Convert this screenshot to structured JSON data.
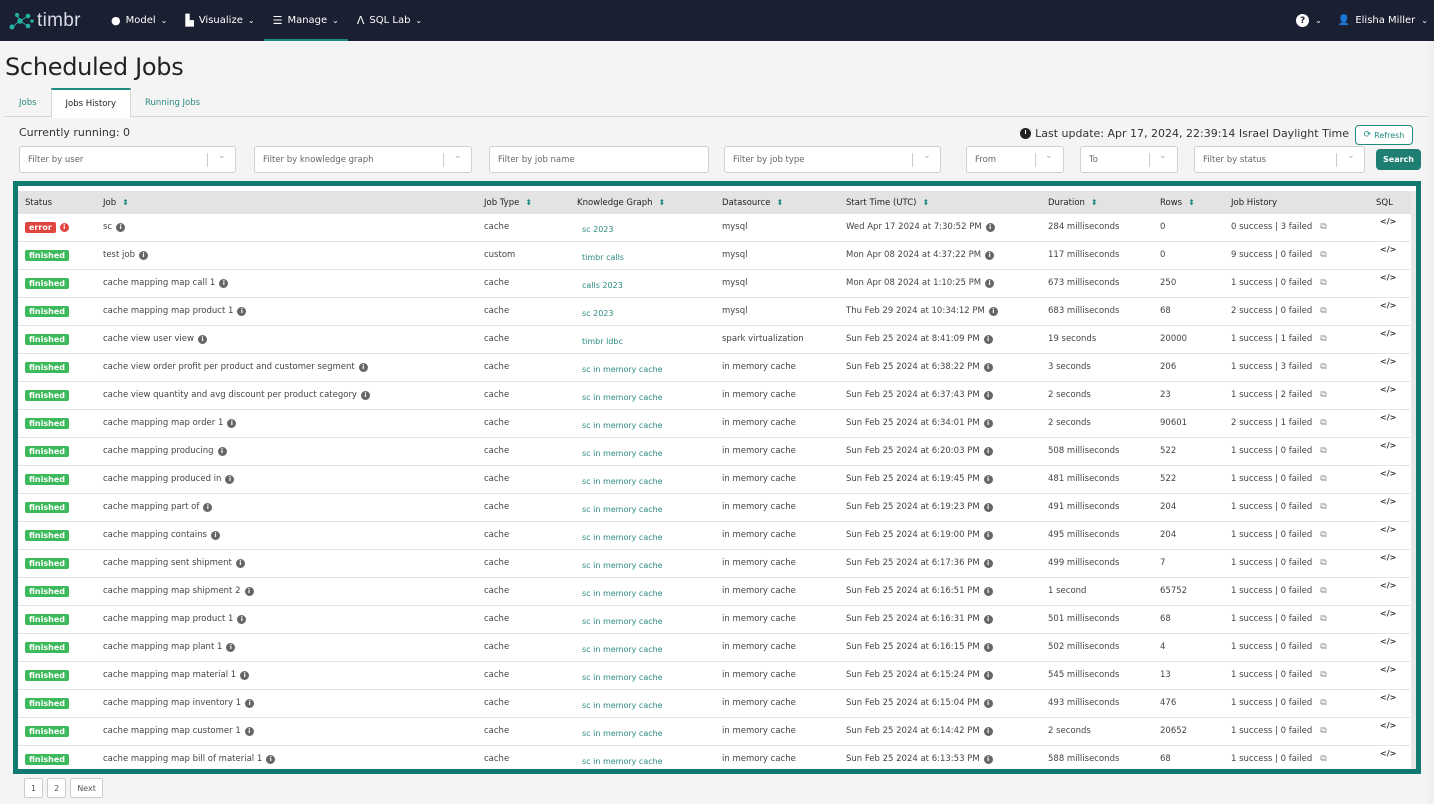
{
  "nav": {
    "brand": "timbr",
    "items": [
      {
        "label": "Model",
        "icon": "lightbulb-icon",
        "glyph": "💡"
      },
      {
        "label": "Visualize",
        "icon": "chart-icon",
        "glyph": "📈"
      },
      {
        "label": "Manage",
        "icon": "database-icon",
        "glyph": "🗄"
      },
      {
        "label": "SQL Lab",
        "icon": "flask-icon",
        "glyph": "⚗"
      }
    ],
    "active": "Manage",
    "help_label": "?",
    "user_name": "Elisha Miller"
  },
  "page": {
    "title": "Scheduled Jobs",
    "tabs": [
      {
        "label": "Jobs",
        "active": false
      },
      {
        "label": "Jobs History",
        "active": true
      },
      {
        "label": "Running Jobs",
        "active": false
      }
    ],
    "currently_running": "Currently running: 0",
    "last_update": "Last update: Apr 17, 2024, 22:39:14 Israel Daylight Time",
    "refresh_label": "Refresh",
    "search_label": "Search"
  },
  "filters": {
    "user": "Filter by user",
    "knowledge_graph": "Filter by knowledge graph",
    "job_name": "Filter by job name",
    "job_type": "Filter by job type",
    "from": "From",
    "to": "To",
    "status": "Filter by status"
  },
  "table": {
    "headers": [
      "Status",
      "Job",
      "Job Type",
      "Knowledge Graph",
      "Datasource",
      "Start Time (UTC)",
      "Duration",
      "Rows",
      "Job History",
      "SQL"
    ],
    "rows": [
      {
        "status": "error",
        "job": "sc",
        "type": "cache",
        "kg": "sc 2023",
        "ds": "mysql",
        "start": "Wed Apr 17 2024 at 7:30:52 PM",
        "duration": "284 milliseconds",
        "rows": "0",
        "history": "0 success | 3 failed"
      },
      {
        "status": "finished",
        "job": "test job",
        "type": "custom",
        "kg": "timbr calls",
        "ds": "mysql",
        "start": "Mon Apr 08 2024 at 4:37:22 PM",
        "duration": "117 milliseconds",
        "rows": "0",
        "history": "9 success | 0 failed"
      },
      {
        "status": "finished",
        "job": "cache mapping map call 1",
        "type": "cache",
        "kg": "calls 2023",
        "ds": "mysql",
        "start": "Mon Apr 08 2024 at 1:10:25 PM",
        "duration": "673 milliseconds",
        "rows": "250",
        "history": "1 success | 0 failed"
      },
      {
        "status": "finished",
        "job": "cache mapping map product 1",
        "type": "cache",
        "kg": "sc 2023",
        "ds": "mysql",
        "start": "Thu Feb 29 2024 at 10:34:12 PM",
        "duration": "683 milliseconds",
        "rows": "68",
        "history": "2 success | 0 failed"
      },
      {
        "status": "finished",
        "job": "cache view user view",
        "type": "cache",
        "kg": "timbr ldbc",
        "ds": "spark virtualization",
        "start": "Sun Feb 25 2024 at 8:41:09 PM",
        "duration": "19 seconds",
        "rows": "20000",
        "history": "1 success | 1 failed"
      },
      {
        "status": "finished",
        "job": "cache view order profit per product and customer segment",
        "type": "cache",
        "kg": "sc in memory cache",
        "ds": "in memory cache",
        "start": "Sun Feb 25 2024 at 6:38:22 PM",
        "duration": "3 seconds",
        "rows": "206",
        "history": "1 success | 3 failed"
      },
      {
        "status": "finished",
        "job": "cache view quantity and avg discount per product category",
        "type": "cache",
        "kg": "sc in memory cache",
        "ds": "in memory cache",
        "start": "Sun Feb 25 2024 at 6:37:43 PM",
        "duration": "2 seconds",
        "rows": "23",
        "history": "1 success | 2 failed"
      },
      {
        "status": "finished",
        "job": "cache mapping map order 1",
        "type": "cache",
        "kg": "sc in memory cache",
        "ds": "in memory cache",
        "start": "Sun Feb 25 2024 at 6:34:01 PM",
        "duration": "2 seconds",
        "rows": "90601",
        "history": "2 success | 1 failed"
      },
      {
        "status": "finished",
        "job": "cache mapping producing",
        "type": "cache",
        "kg": "sc in memory cache",
        "ds": "in memory cache",
        "start": "Sun Feb 25 2024 at 6:20:03 PM",
        "duration": "508 milliseconds",
        "rows": "522",
        "history": "1 success | 0 failed"
      },
      {
        "status": "finished",
        "job": "cache mapping produced in",
        "type": "cache",
        "kg": "sc in memory cache",
        "ds": "in memory cache",
        "start": "Sun Feb 25 2024 at 6:19:45 PM",
        "duration": "481 milliseconds",
        "rows": "522",
        "history": "1 success | 0 failed"
      },
      {
        "status": "finished",
        "job": "cache mapping part of",
        "type": "cache",
        "kg": "sc in memory cache",
        "ds": "in memory cache",
        "start": "Sun Feb 25 2024 at 6:19:23 PM",
        "duration": "491 milliseconds",
        "rows": "204",
        "history": "1 success | 0 failed"
      },
      {
        "status": "finished",
        "job": "cache mapping contains",
        "type": "cache",
        "kg": "sc in memory cache",
        "ds": "in memory cache",
        "start": "Sun Feb 25 2024 at 6:19:00 PM",
        "duration": "495 milliseconds",
        "rows": "204",
        "history": "1 success | 0 failed"
      },
      {
        "status": "finished",
        "job": "cache mapping sent shipment",
        "type": "cache",
        "kg": "sc in memory cache",
        "ds": "in memory cache",
        "start": "Sun Feb 25 2024 at 6:17:36 PM",
        "duration": "499 milliseconds",
        "rows": "7",
        "history": "1 success | 0 failed"
      },
      {
        "status": "finished",
        "job": "cache mapping map shipment 2",
        "type": "cache",
        "kg": "sc in memory cache",
        "ds": "in memory cache",
        "start": "Sun Feb 25 2024 at 6:16:51 PM",
        "duration": "1 second",
        "rows": "65752",
        "history": "1 success | 0 failed"
      },
      {
        "status": "finished",
        "job": "cache mapping map product 1",
        "type": "cache",
        "kg": "sc in memory cache",
        "ds": "in memory cache",
        "start": "Sun Feb 25 2024 at 6:16:31 PM",
        "duration": "501 milliseconds",
        "rows": "68",
        "history": "1 success | 0 failed"
      },
      {
        "status": "finished",
        "job": "cache mapping map plant 1",
        "type": "cache",
        "kg": "sc in memory cache",
        "ds": "in memory cache",
        "start": "Sun Feb 25 2024 at 6:16:15 PM",
        "duration": "502 milliseconds",
        "rows": "4",
        "history": "1 success | 0 failed"
      },
      {
        "status": "finished",
        "job": "cache mapping map material 1",
        "type": "cache",
        "kg": "sc in memory cache",
        "ds": "in memory cache",
        "start": "Sun Feb 25 2024 at 6:15:24 PM",
        "duration": "545 milliseconds",
        "rows": "13",
        "history": "1 success | 0 failed"
      },
      {
        "status": "finished",
        "job": "cache mapping map inventory 1",
        "type": "cache",
        "kg": "sc in memory cache",
        "ds": "in memory cache",
        "start": "Sun Feb 25 2024 at 6:15:04 PM",
        "duration": "493 milliseconds",
        "rows": "476",
        "history": "1 success | 0 failed"
      },
      {
        "status": "finished",
        "job": "cache mapping map customer 1",
        "type": "cache",
        "kg": "sc in memory cache",
        "ds": "in memory cache",
        "start": "Sun Feb 25 2024 at 6:14:42 PM",
        "duration": "2 seconds",
        "rows": "20652",
        "history": "1 success | 0 failed"
      },
      {
        "status": "finished",
        "job": "cache mapping map bill of material 1",
        "type": "cache",
        "kg": "sc in memory cache",
        "ds": "in memory cache",
        "start": "Sun Feb 25 2024 at 6:13:53 PM",
        "duration": "588 milliseconds",
        "rows": "68",
        "history": "1 success | 0 failed"
      }
    ],
    "sql_icon": "</>"
  },
  "pagination": {
    "pages": [
      "1",
      "2"
    ],
    "next_label": "Next"
  },
  "colors": {
    "accent": "#1e8c7e",
    "frame": "#107a70",
    "nav_bg": "#1b1f32",
    "finished": "#3cb95a",
    "error": "#e0463f"
  }
}
